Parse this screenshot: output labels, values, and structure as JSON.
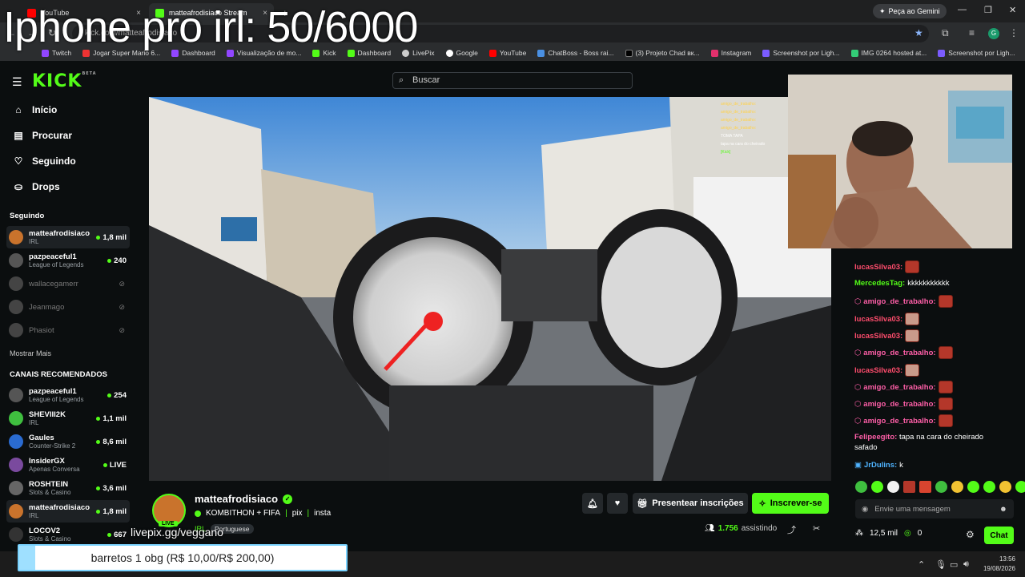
{
  "overlay": {
    "title": "Iphone pro irl: 50/6000"
  },
  "browser": {
    "tabs": [
      {
        "label": "YouTube",
        "close": "×"
      },
      {
        "label": "matteafrodisiaco Stream",
        "close": "×"
      }
    ],
    "new_tab": "+",
    "gemini_label": "Peça ao Gemini",
    "url": "kick.com/matteafrodisiaco",
    "profile_initial": "G",
    "bookmarks": [
      "Twitch",
      "Jogar Super Mario 6...",
      "Dashboard",
      "Visualização de mo...",
      "Kick",
      "Dashboard",
      "LivePix",
      "Google",
      "YouTube",
      "ChatBoss - Boss rai...",
      "(3) Projeto Chad вк...",
      "Instagram",
      "Screenshot por Ligh...",
      "IMG 0264 hosted at...",
      "Screenshot por Ligh..."
    ]
  },
  "kick": {
    "logo": "KICK",
    "logo_beta": "BETA",
    "search_placeholder": "Buscar"
  },
  "sidebar": {
    "nav": [
      {
        "label": "Início",
        "icon": "home-icon"
      },
      {
        "label": "Procurar",
        "icon": "browse-icon"
      },
      {
        "label": "Seguindo",
        "icon": "heart-icon"
      },
      {
        "label": "Drops",
        "icon": "drops-icon"
      }
    ],
    "following_title": "Seguindo",
    "following": [
      {
        "name": "matteafrodisiaco",
        "category": "IRL",
        "viewers": "1,8 mil",
        "live": true
      },
      {
        "name": "pazpeaceful1",
        "category": "League of Legends",
        "viewers": "240",
        "live": true
      },
      {
        "name": "wallacegamerr",
        "category": "",
        "viewers": "",
        "live": false
      },
      {
        "name": "Jeanmago",
        "category": "",
        "viewers": "",
        "live": false
      },
      {
        "name": "Phasiot",
        "category": "",
        "viewers": "",
        "live": false
      }
    ],
    "show_more": "Mostrar Mais",
    "recommended_title": "CANAIS RECOMENDADOS",
    "recommended": [
      {
        "name": "pazpeaceful1",
        "category": "League of Legends",
        "viewers": "254"
      },
      {
        "name": "SHEVIII2K",
        "category": "IRL",
        "viewers": "1,1 mil"
      },
      {
        "name": "Gaules",
        "category": "Counter-Strike 2",
        "viewers": "8,6 mil"
      },
      {
        "name": "InsiderGX",
        "category": "Apenas Conversa",
        "viewers": "LIVE"
      },
      {
        "name": "ROSHTEIN",
        "category": "Slots & Casino",
        "viewers": "3,6 mil"
      },
      {
        "name": "matteafrodisiaco",
        "category": "IRL",
        "viewers": "1,8 mil"
      },
      {
        "name": "LOCOV2",
        "category": "Slots & Casino",
        "viewers": "667"
      }
    ]
  },
  "stream": {
    "channel": "matteafrodisiaco",
    "title_parts": [
      "KOMBITHON + FIFA",
      "pix",
      "insta"
    ],
    "category": "IRL",
    "language": "Portuguese",
    "live_badge": "LIVE",
    "viewers": "1.756",
    "viewers_label": "assistindo",
    "gift_label": "Presentear inscrições",
    "subscribe_label": "Inscrever-se"
  },
  "ingame_chat": [
    "amigo_de_trabalho:",
    "amigo_de_trabalho:",
    "amigo_de_trabalho:",
    "amigo_de_trabalho:",
    "TOMA TAPA",
    "tapa na cara do cheirado",
    "[Kick]"
  ],
  "chat": {
    "messages": [
      {
        "user": "lucasSilva03:",
        "text": "",
        "color": "#ff4d6d",
        "badge": false,
        "emote": true
      },
      {
        "user": "MercedesTag:",
        "text": "kkkkkkkkkkk",
        "color": "#53fc18",
        "badge": false,
        "emote": false
      },
      {
        "user": "amigo_de_trabalho:",
        "text": "",
        "color": "#ff5fa8",
        "badge": true,
        "emote": true
      },
      {
        "user": "lucasSilva03:",
        "text": "",
        "color": "#ff4d6d",
        "badge": false,
        "emote": true
      },
      {
        "user": "lucasSilva03:",
        "text": "",
        "color": "#ff4d6d",
        "badge": false,
        "emote": true
      },
      {
        "user": "amigo_de_trabalho:",
        "text": "",
        "color": "#ff5fa8",
        "badge": true,
        "emote": true
      },
      {
        "user": "lucasSilva03:",
        "text": "",
        "color": "#ff4d6d",
        "badge": false,
        "emote": true
      },
      {
        "user": "amigo_de_trabalho:",
        "text": "",
        "color": "#ff5fa8",
        "badge": true,
        "emote": true
      },
      {
        "user": "amigo_de_trabalho:",
        "text": "",
        "color": "#ff5fa8",
        "badge": true,
        "emote": true
      },
      {
        "user": "amigo_de_trabalho:",
        "text": "",
        "color": "#ff5fa8",
        "badge": true,
        "emote": true
      },
      {
        "user": "Felipeegito:",
        "text": "tapa na cara do cheirado",
        "text2": "safado",
        "color": "#ff5fa8",
        "badge": false,
        "emote": false
      },
      {
        "user": "JrDulins:",
        "text": "k",
        "color": "#4fb3ff",
        "badge": true,
        "emote": false
      }
    ],
    "input_placeholder": "Envie uma mensagem",
    "points": "12,5 mil",
    "other_points": "0",
    "send_label": "Chat"
  },
  "overlays": {
    "livepix": "livepix.gg/veggano",
    "donation": "barretos 1 obg (R$ 10,00/R$ 200,00)",
    "donation_progress": 0.05
  },
  "taskbar": {
    "time": "13:56",
    "date": "19/08/2026"
  },
  "colors": {
    "accent": "#53fc18",
    "bg": "#0b0e0f"
  }
}
